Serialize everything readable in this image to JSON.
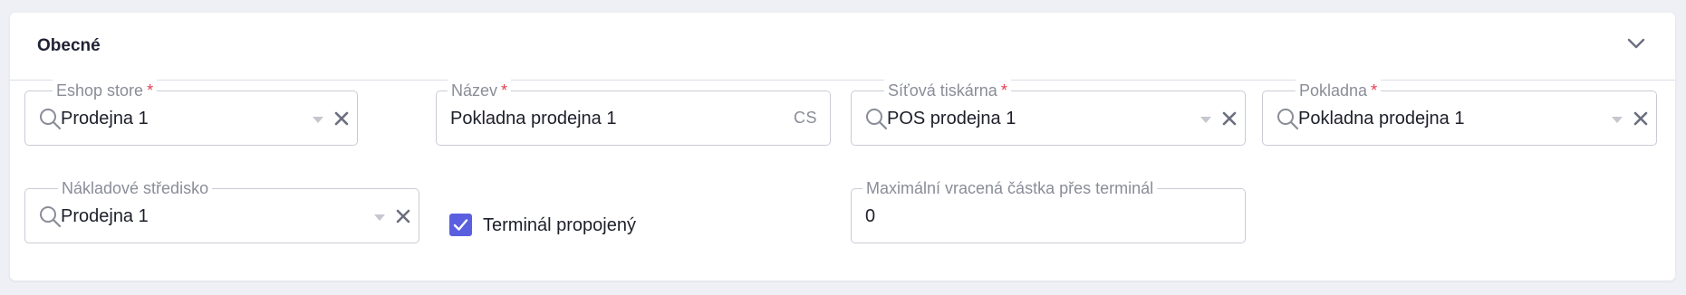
{
  "section": {
    "title": "Obecné"
  },
  "fields": {
    "eshop_store": {
      "label": "Eshop store",
      "required_mark": "*",
      "value": "Prodejna 1"
    },
    "nazev": {
      "label": "Název",
      "required_mark": "*",
      "value": "Pokladna prodejna 1",
      "lang": "CS"
    },
    "sitova_tiskarna": {
      "label": "Síťová tiskárna",
      "required_mark": "*",
      "value": "POS prodejna 1"
    },
    "pokladna": {
      "label": "Pokladna",
      "required_mark": "*",
      "value": "Pokladna prodejna 1"
    },
    "nakladove_stredisko": {
      "label": "Nákladové středisko",
      "value": "Prodejna 1"
    },
    "terminal_propojeny": {
      "label": "Terminál propojený",
      "checked": true
    },
    "max_vracena_castka": {
      "label": "Maximální vracená částka přes terminál",
      "value": "0"
    }
  },
  "icons": {
    "collapse": "chevron-down-icon",
    "search": "search-icon",
    "dropdown": "caret-down-icon",
    "clear": "close-icon",
    "checkbox": "checkmark-icon"
  },
  "colors": {
    "accent": "#5a5fe0",
    "required": "#e53e4f",
    "border": "#c9ccd6",
    "label": "#8a8d98",
    "background": "#eef0f5"
  }
}
